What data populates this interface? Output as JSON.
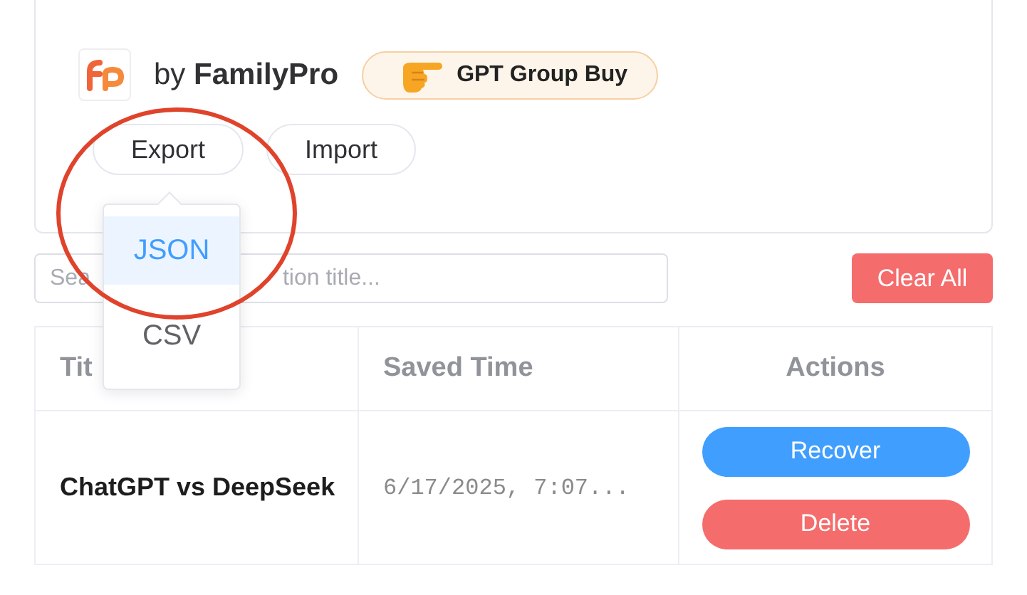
{
  "header": {
    "brand": "by",
    "brand_name": "FamilyPro",
    "promo": "GPT Group Buy"
  },
  "buttons": [
    {
      "label": "Export",
      "expanded": true
    },
    {
      "label": "Import",
      "expanded": false
    }
  ],
  "export_menu": [
    {
      "label": "JSON",
      "selected": true
    },
    {
      "label": "CSV",
      "selected": false
    }
  ],
  "search": {
    "hint_parts": [
      "Sea",
      "tion title..."
    ]
  },
  "clear_button": "Clear All",
  "table": {
    "columns": [
      "Tit",
      "Saved Time",
      "Actions"
    ],
    "rows": [
      {
        "title": "ChatGPT vs DeepSeek",
        "saved_time": "6/17/2025, 7:07...",
        "actions": [
          {
            "label": "Recover",
            "kind": "recover"
          },
          {
            "label": "Delete",
            "kind": "delete"
          }
        ]
      }
    ]
  },
  "annotations": [
    {
      "kind": "ellipse"
    }
  ]
}
